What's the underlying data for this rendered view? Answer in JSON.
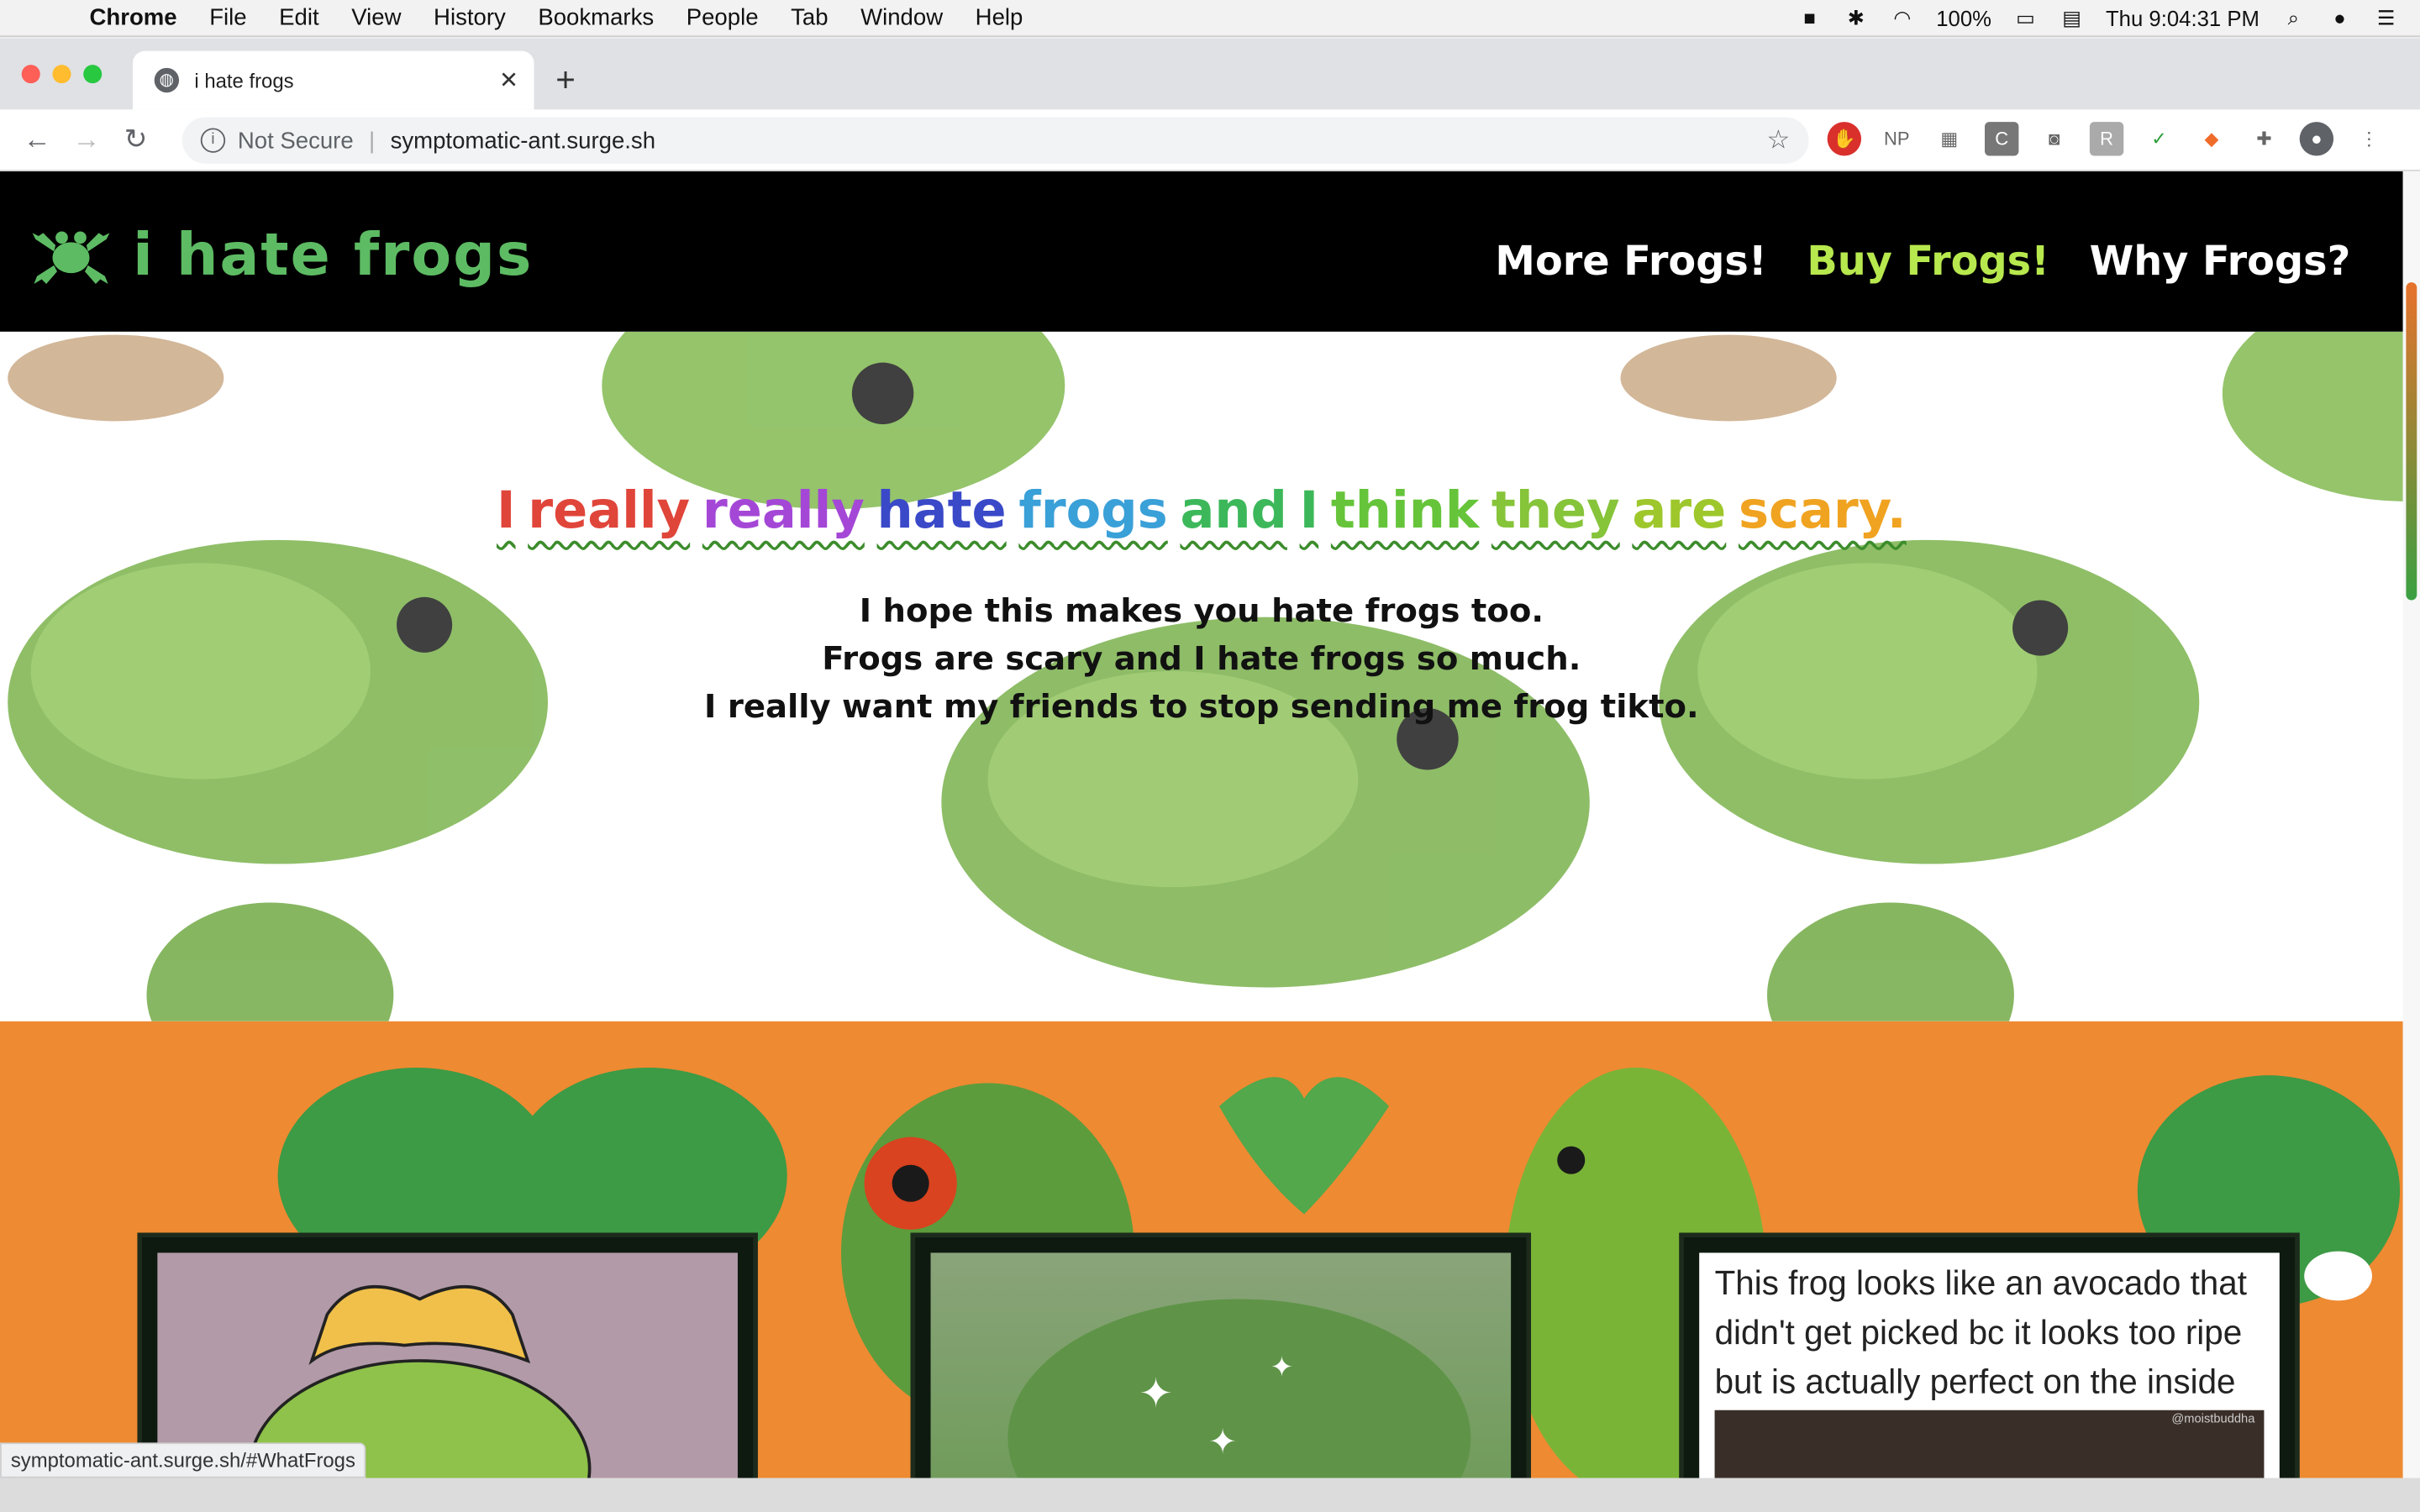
{
  "menubar": {
    "app": "Chrome",
    "items": [
      "File",
      "Edit",
      "View",
      "History",
      "Bookmarks",
      "People",
      "Tab",
      "Window",
      "Help"
    ],
    "battery": "100%",
    "clock": "Thu 9:04:31 PM",
    "icons": [
      "camera-icon",
      "bluetooth-icon",
      "wifi-icon",
      "battery-icon",
      "flag-icon",
      "search-icon",
      "siri-icon",
      "list-icon"
    ]
  },
  "browser": {
    "tab_title": "i hate frogs",
    "security": "Not Secure",
    "url": "symptomatic-ant.surge.sh",
    "status_url": "symptomatic-ant.surge.sh/#WhatFrogs"
  },
  "site": {
    "logo": "i hate frogs",
    "nav": [
      "More Frogs!",
      "Buy Frogs!",
      "Why Frogs?"
    ],
    "active_nav": "Buy Frogs!",
    "hero_title_words": [
      {
        "w": "I",
        "c": "#e0453a"
      },
      {
        "w": "really",
        "c": "#e0453a"
      },
      {
        "w": "really",
        "c": "#a447d6"
      },
      {
        "w": "hate",
        "c": "#3a49c8"
      },
      {
        "w": "frogs",
        "c": "#3aa0d8"
      },
      {
        "w": "and",
        "c": "#3cb85a"
      },
      {
        "w": "I",
        "c": "#3cb85a"
      },
      {
        "w": "think",
        "c": "#66c43a"
      },
      {
        "w": "they",
        "c": "#86c43a"
      },
      {
        "w": "are",
        "c": "#9ec72c"
      },
      {
        "w": "scary.",
        "c": "#f0a320"
      }
    ],
    "hero_lines": [
      "I hope this makes you hate frogs too.",
      "Frogs are scary and I hate frogs so much.",
      "I really want my friends to stop sending me frog tikto."
    ],
    "card3_text": "This frog looks like an avocado that didn't get picked bc it looks too ripe but is actually perfect on the inside",
    "card3_credit": "@moistbuddha"
  },
  "colors": {
    "brand_green": "#5dbb63",
    "active_nav": "#b7e84e",
    "orange_bg": "#ee8a32"
  }
}
